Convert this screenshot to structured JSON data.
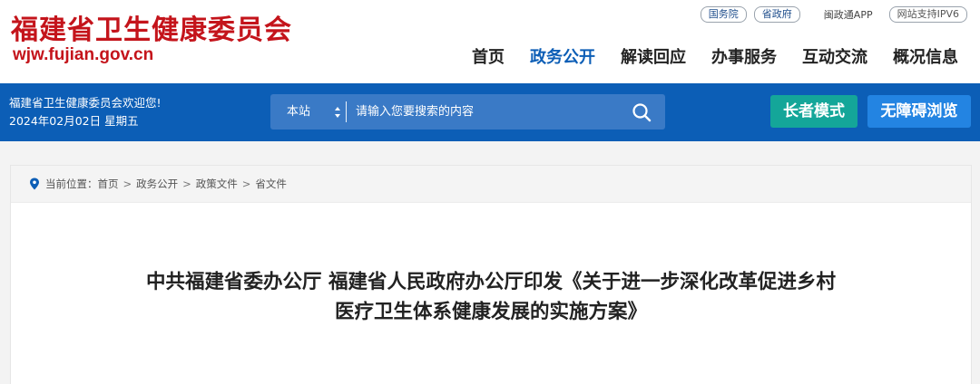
{
  "header": {
    "site_name": "福建省卫生健康委员会",
    "site_url": "wjw.fujian.gov.cn",
    "top_links": [
      {
        "label": "国务院"
      },
      {
        "label": "省政府"
      }
    ],
    "app_link": "闽政通APP",
    "ipv6_badge": "网站支持IPV6",
    "nav": [
      {
        "label": "首页"
      },
      {
        "label": "政务公开"
      },
      {
        "label": "解读回应"
      },
      {
        "label": "办事服务"
      },
      {
        "label": "互动交流"
      },
      {
        "label": "概况信息"
      }
    ],
    "active_nav": "政务公开"
  },
  "band": {
    "welcome": "福建省卫生健康委员会欢迎您!",
    "date": "2024年02月02日 星期五",
    "search": {
      "scope": "本站",
      "placeholder": "请输入您要搜索的内容"
    },
    "elder_mode": "长者模式",
    "accessible": "无障碍浏览"
  },
  "breadcrumb": {
    "prefix": "当前位置：",
    "items": [
      "首页",
      "政务公开",
      "政策文件",
      "省文件"
    ],
    "separator": ">"
  },
  "article": {
    "title_line1": "中共福建省委办公厅 福建省人民政府办公厅印发《关于进一步深化改革促进乡村",
    "title_line2": "医疗卫生体系健康发展的实施方案》"
  },
  "colors": {
    "brand_red": "#c4141b",
    "primary_blue": "#0c5eb6",
    "elder_green": "#14a699",
    "access_blue": "#2384e2"
  }
}
